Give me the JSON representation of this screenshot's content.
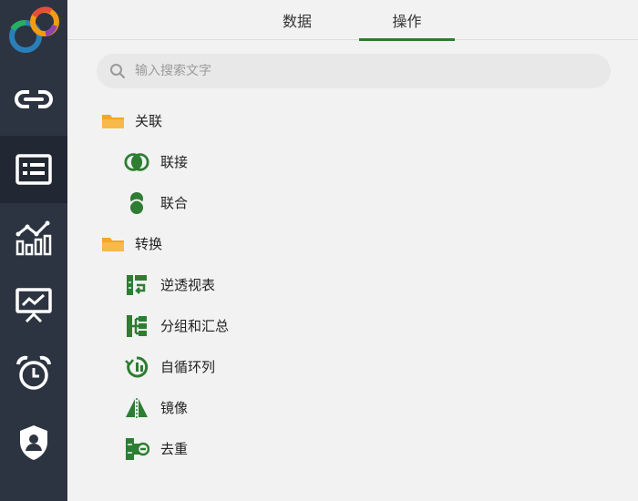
{
  "brand": {
    "logo_colors": [
      "#e84c3d",
      "#f39c12",
      "#27ae60",
      "#2980b9",
      "#8e44ad"
    ]
  },
  "rail": {
    "items": [
      {
        "icon": "link-icon"
      },
      {
        "icon": "list-card-icon",
        "active": true
      },
      {
        "icon": "bar-line-chart-icon"
      },
      {
        "icon": "presentation-chart-icon"
      },
      {
        "icon": "alarm-clock-icon"
      },
      {
        "icon": "shield-user-icon"
      }
    ]
  },
  "tabs": [
    {
      "label": "数据"
    },
    {
      "label": "操作",
      "active": true
    }
  ],
  "search": {
    "placeholder": "输入搜索文字"
  },
  "tree": {
    "groups": [
      {
        "label": "关联",
        "icon": "folder-icon",
        "items": [
          {
            "label": "联接",
            "icon": "join-icon"
          },
          {
            "label": "联合",
            "icon": "union-icon"
          }
        ]
      },
      {
        "label": "转换",
        "icon": "folder-icon",
        "items": [
          {
            "label": "逆透视表",
            "icon": "unpivot-icon"
          },
          {
            "label": "分组和汇总",
            "icon": "group-summarize-icon"
          },
          {
            "label": "自循环列",
            "icon": "self-loop-column-icon"
          },
          {
            "label": "镜像",
            "icon": "mirror-icon"
          },
          {
            "label": "去重",
            "icon": "dedupe-icon"
          }
        ]
      }
    ]
  },
  "colors": {
    "accent": "#2e7d32",
    "folder": "#f5a623",
    "rail_bg": "#2d3441",
    "rail_active": "#222833"
  }
}
